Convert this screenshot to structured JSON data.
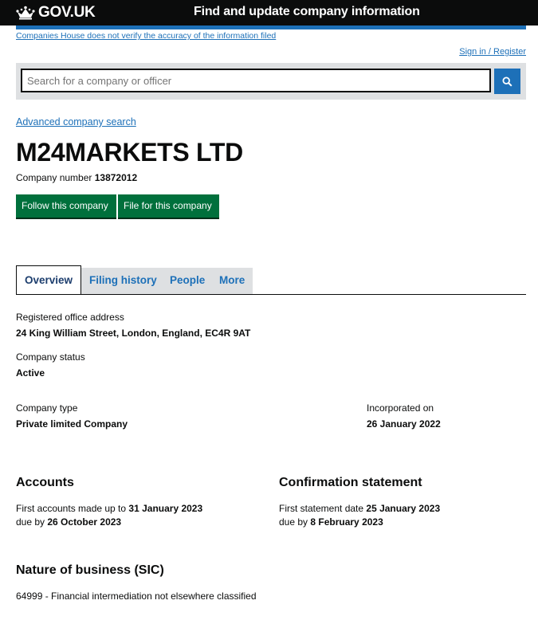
{
  "header": {
    "logo_text": "GOV.UK",
    "service_name": "Find and update company information",
    "disclaimer": "Companies House does not verify the accuracy of the information filed",
    "signin": "Sign in / Register"
  },
  "search": {
    "placeholder": "Search for a company or officer",
    "advanced_link": "Advanced company search"
  },
  "company": {
    "name": "M24MARKETS LTD",
    "number_label": "Company number",
    "number": "13872012",
    "follow_button": "Follow this company",
    "file_button": "File for this company"
  },
  "tabs": [
    {
      "label": "Overview"
    },
    {
      "label": "Filing history"
    },
    {
      "label": "People"
    },
    {
      "label": "More"
    }
  ],
  "overview": {
    "address_label": "Registered office address",
    "address": "24 King William Street, London, England, EC4R 9AT",
    "status_label": "Company status",
    "status": "Active",
    "type_label": "Company type",
    "type": "Private limited Company",
    "incorporated_label": "Incorporated on",
    "incorporated": "26 January 2022"
  },
  "accounts": {
    "heading": "Accounts",
    "made_up_label": "First accounts made up to",
    "made_up": "31 January 2023",
    "due_label": "due by",
    "due": "26 October 2023"
  },
  "confirmation": {
    "heading": "Confirmation statement",
    "date_label": "First statement date",
    "date": "25 January 2023",
    "due_label": "due by",
    "due": "8 February 2023"
  },
  "sic": {
    "heading": "Nature of business (SIC)",
    "entry": "64999 - Financial intermediation not elsewhere classified"
  },
  "colors": {
    "link": "#1d70b8",
    "button": "#00703c",
    "header": "#0b0c0c"
  }
}
